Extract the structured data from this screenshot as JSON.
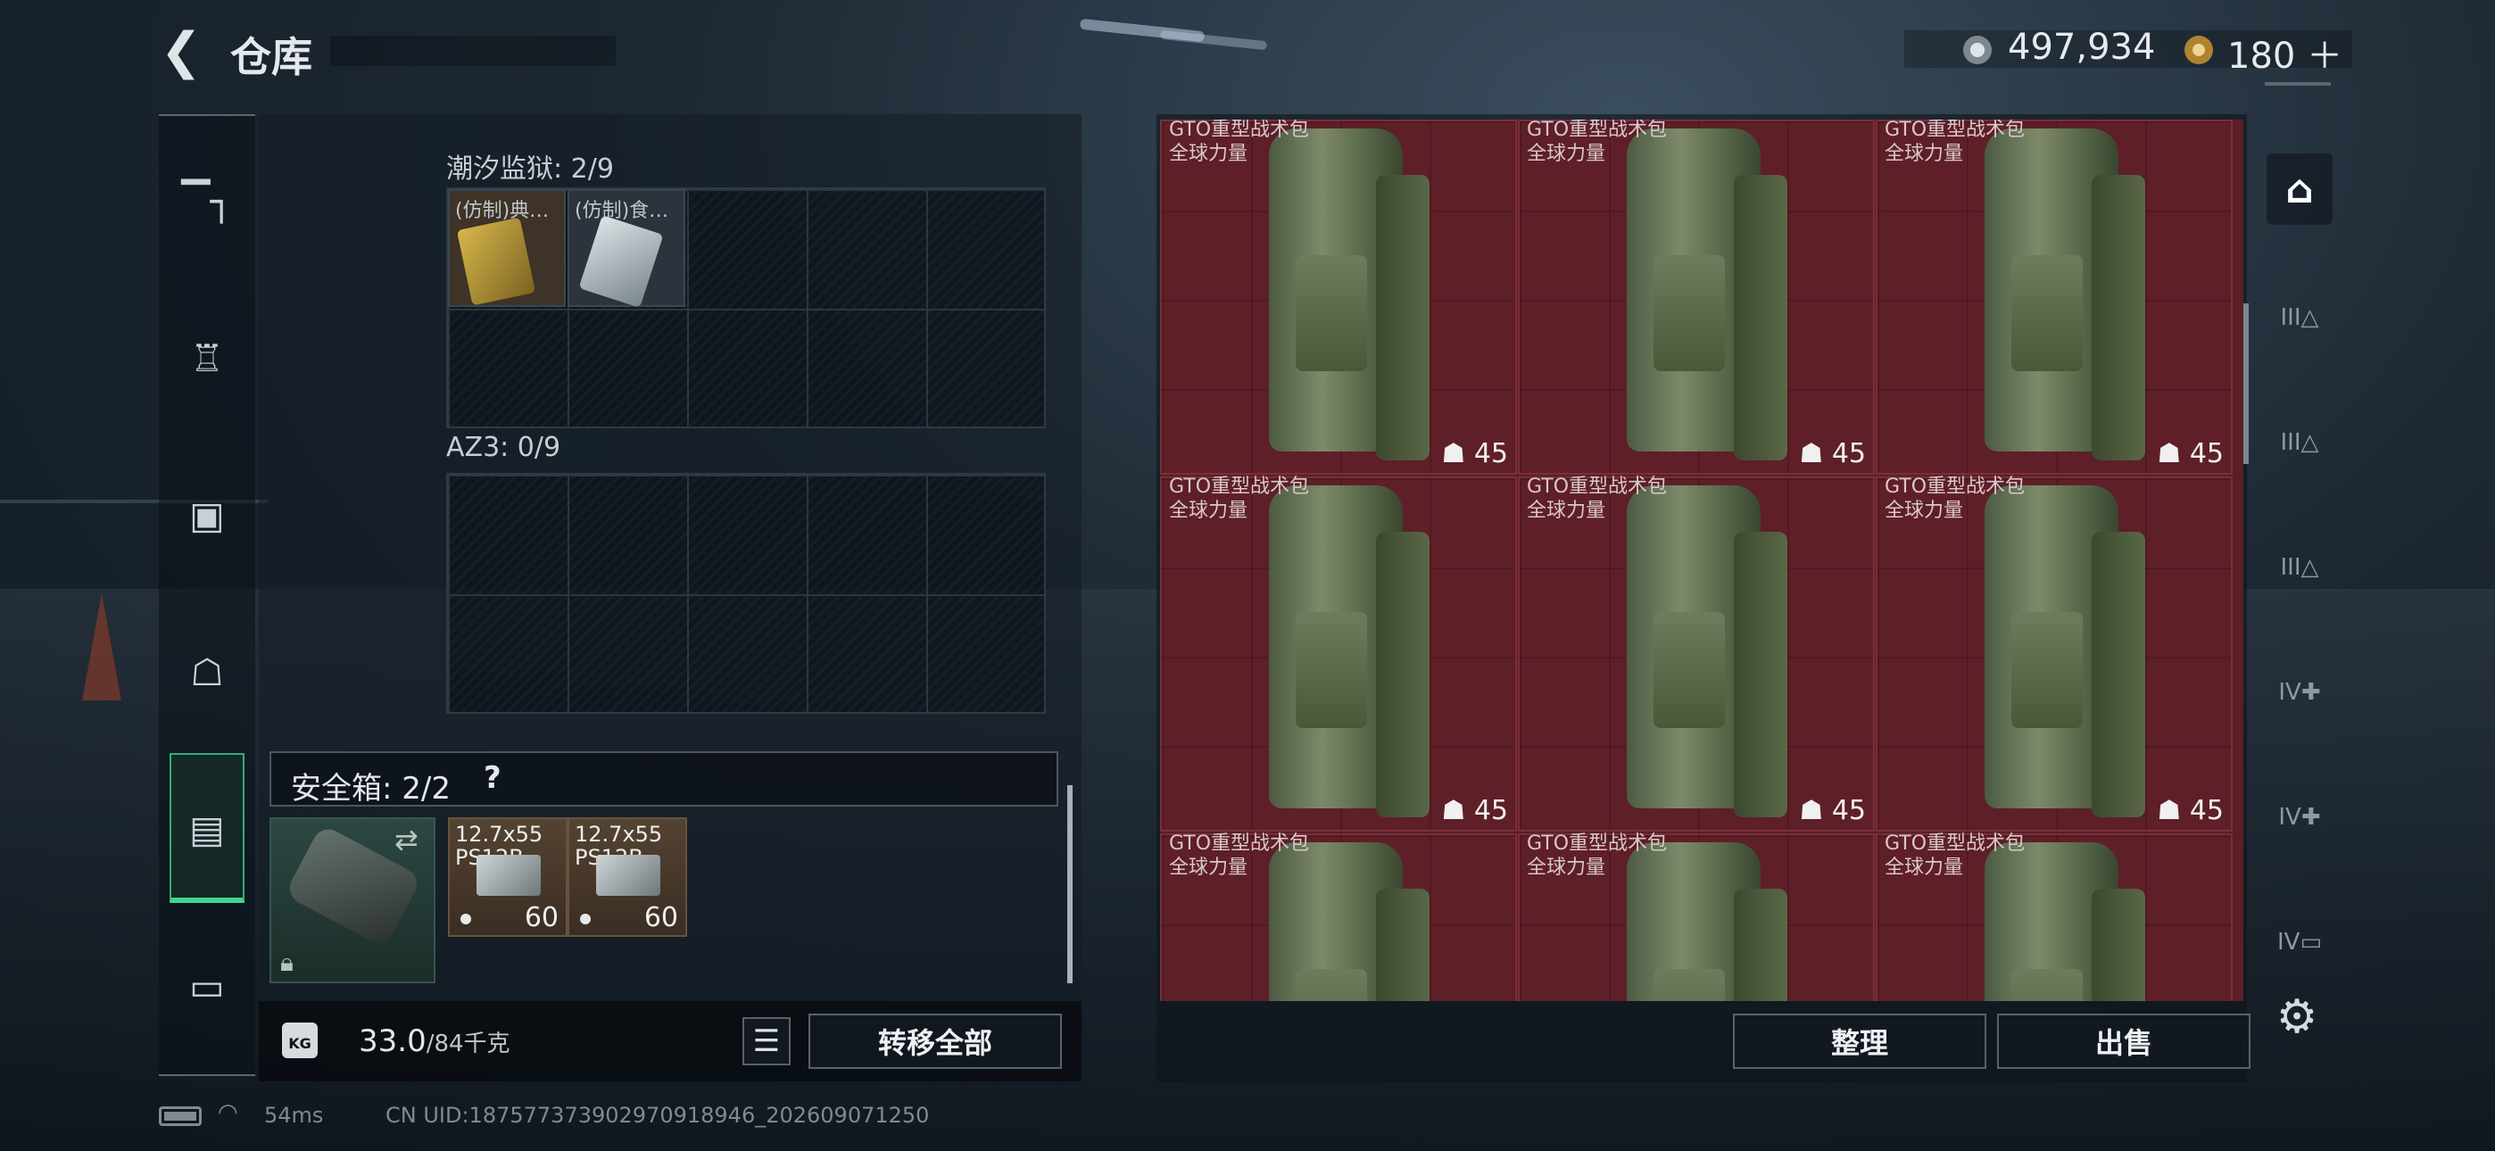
{
  "header": {
    "title": "仓库",
    "coins": "497,934",
    "premium": "180"
  },
  "left_nav": {
    "icons": [
      "pistol-icon",
      "vest-icon",
      "backpack-icon",
      "bag-icon",
      "case-icon",
      "toolbox-icon"
    ],
    "active": 4
  },
  "containers": {
    "tidal_prison": {
      "label": "潮汐监狱: 2/9",
      "items": [
        {
          "name": "(仿制)典…"
        },
        {
          "name": "(仿制)食…"
        }
      ]
    },
    "az3": {
      "label": "AZ3: 0/9"
    }
  },
  "safe_box": {
    "label": "安全箱: 2/2",
    "help": "?",
    "ammo": [
      {
        "name": "12.7x55\nPS12B",
        "qty": "60"
      },
      {
        "name": "12.7x55\nPS12B",
        "qty": "60"
      }
    ]
  },
  "weight": {
    "current": "33.0",
    "max": "/84千克",
    "kg_badge": "KG"
  },
  "buttons": {
    "transfer_all": "转移全部",
    "sort": "整理",
    "sell": "出售"
  },
  "stash": {
    "items": [
      {
        "name": "GTO重型战术包",
        "sub": "全球力量",
        "capacity": "45"
      },
      {
        "name": "GTO重型战术包",
        "sub": "全球力量",
        "capacity": "45"
      },
      {
        "name": "GTO重型战术包",
        "sub": "全球力量",
        "capacity": "45"
      },
      {
        "name": "GTO重型战术包",
        "sub": "全球力量",
        "capacity": "45"
      },
      {
        "name": "GTO重型战术包",
        "sub": "全球力量",
        "capacity": "45"
      },
      {
        "name": "GTO重型战术包",
        "sub": "全球力量",
        "capacity": "45"
      },
      {
        "name": "GTO重型战术包",
        "sub": "全球力量",
        "capacity": ""
      },
      {
        "name": "GTO重型战术包",
        "sub": "全球力量",
        "capacity": ""
      },
      {
        "name": "GTO重型战术包",
        "sub": "全球力量",
        "capacity": ""
      }
    ]
  },
  "right_tabs": [
    "III",
    "III",
    "III",
    "IV",
    "IV",
    "IV"
  ],
  "status": {
    "ping": "54ms",
    "uid": "CN UID:187577373902970918946_202609071250"
  },
  "colors": {
    "accent": "#3ed68f",
    "stash_bg": "#5c1e26"
  }
}
